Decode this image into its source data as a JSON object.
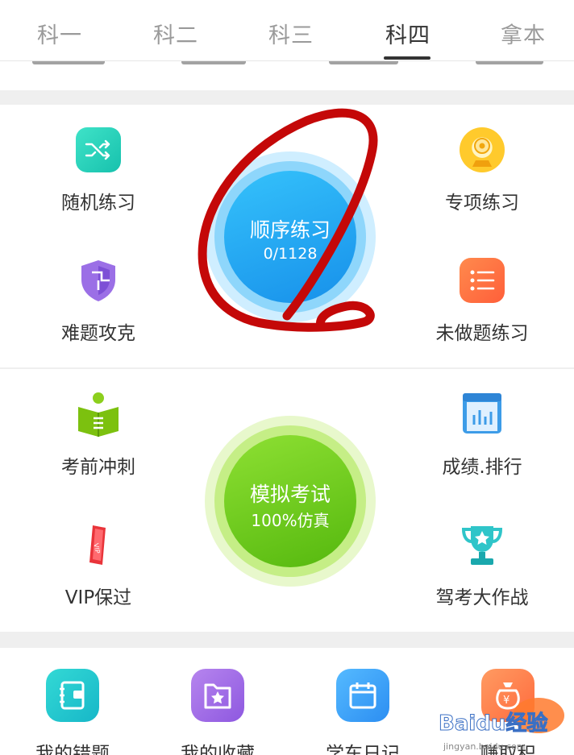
{
  "tabs": [
    {
      "label": "科一"
    },
    {
      "label": "科二"
    },
    {
      "label": "科三"
    },
    {
      "label": "科四"
    },
    {
      "label": "拿本"
    }
  ],
  "active_tab": "科四",
  "practice_section": {
    "random_practice": {
      "label": "随机练习",
      "icon": "shuffle-icon"
    },
    "special_practice": {
      "label": "专项练习",
      "icon": "webcam-icon"
    },
    "difficult_questions": {
      "label": "难题攻克",
      "icon": "shield-icon"
    },
    "undone_practice": {
      "label": "未做题练习",
      "icon": "list-icon"
    },
    "sequence_practice": {
      "label": "顺序练习",
      "progress": "0/1128"
    }
  },
  "exam_section": {
    "pre_exam_sprint": {
      "label": "考前冲刺",
      "icon": "book-reader-icon"
    },
    "score_ranking": {
      "label": "成绩.排行",
      "icon": "bar-chart-book-icon"
    },
    "vip_pass": {
      "label": "VIP保过",
      "icon": "vip-card-icon"
    },
    "driving_battle": {
      "label": "驾考大作战",
      "icon": "trophy-icon"
    },
    "mock_exam": {
      "label": "模拟考试",
      "subtitle": "100%仿真"
    }
  },
  "bottom_row": [
    {
      "label": "我的错题",
      "icon": "notebook-icon"
    },
    {
      "label": "我的收藏",
      "icon": "star-folder-icon"
    },
    {
      "label": "学车日记",
      "icon": "calendar-icon"
    },
    {
      "label": "赚取积",
      "icon": "money-bag-icon"
    }
  ],
  "watermark": {
    "text": "Baidu经验",
    "sub": "jingyan.baidu.com"
  },
  "colors": {
    "sequence_circle": "#1aa0f0",
    "mock_circle": "#6cc619",
    "annotation": "#c40808"
  }
}
